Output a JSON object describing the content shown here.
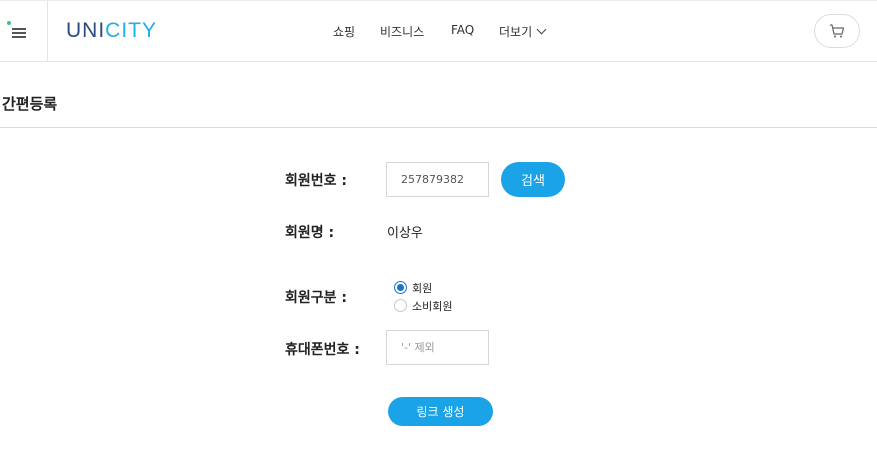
{
  "header": {
    "logo": {
      "part1": "UNI",
      "part2": "CITY"
    },
    "nav": {
      "shop": "쇼핑",
      "business": "비즈니스",
      "faq": "FAQ",
      "more": "더보기"
    }
  },
  "page": {
    "title": "간편등록"
  },
  "form": {
    "member_no_label": "회원번호 :",
    "member_no_value": "257879382",
    "search_button": "검색",
    "member_name_label": "회원명 :",
    "member_name_value": "이상우",
    "member_type_label": "회원구분 :",
    "member_type_options": [
      "회원",
      "소비회원"
    ],
    "member_type_selected": "회원",
    "phone_label": "휴대폰번호 :",
    "phone_placeholder": "'-' 제외",
    "create_link_button": "링크 생성"
  },
  "colors": {
    "brand_primary": "#2e4b7e",
    "brand_accent": "#22aee6",
    "button": "#1aa3e6"
  }
}
